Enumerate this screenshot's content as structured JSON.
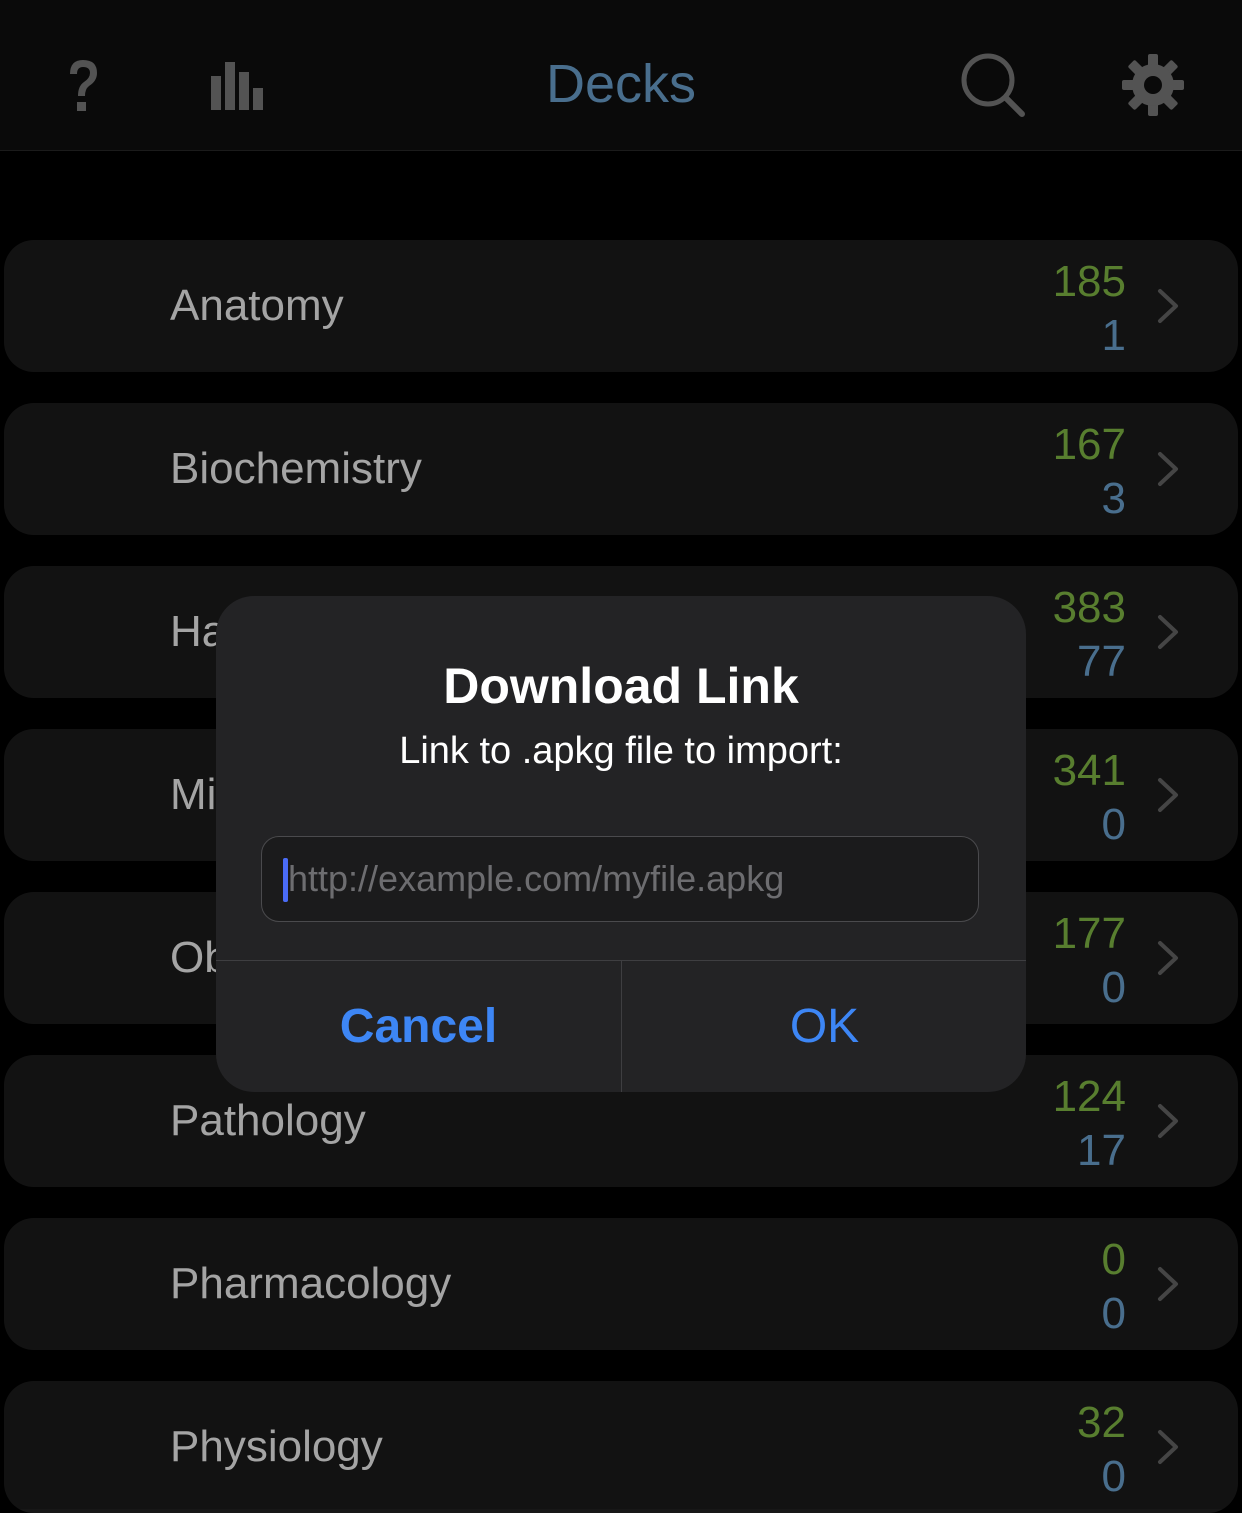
{
  "navbar": {
    "title": "Decks",
    "help_icon": "question-mark-icon",
    "stats_icon": "bar-chart-icon",
    "search_icon": "magnifying-glass-icon",
    "settings_icon": "gear-icon",
    "title_color": "#5a87ad"
  },
  "decks": [
    {
      "name": "Anatomy",
      "new": "185",
      "due": "1"
    },
    {
      "name": "Biochemistry",
      "new": "167",
      "due": "3"
    },
    {
      "name": "Ha",
      "new": "383",
      "due": "77"
    },
    {
      "name": "Mi",
      "new": "341",
      "due": "0"
    },
    {
      "name": "Ob",
      "new": "177",
      "due": "0"
    },
    {
      "name": "Pathology",
      "new": "124",
      "due": "17"
    },
    {
      "name": "Pharmacology",
      "new": "0",
      "due": "0"
    },
    {
      "name": "Physiology",
      "new": "32",
      "due": "0"
    }
  ],
  "colors": {
    "new_count": "#6c9a3a",
    "due_count": "#5a87ad",
    "dialog_button": "#3d86f5"
  },
  "dialog": {
    "title": "Download Link",
    "message": "Link to .apkg file to import:",
    "input_value": "",
    "input_placeholder": "http://example.com/myfile.apkg",
    "cancel_label": "Cancel",
    "ok_label": "OK"
  }
}
